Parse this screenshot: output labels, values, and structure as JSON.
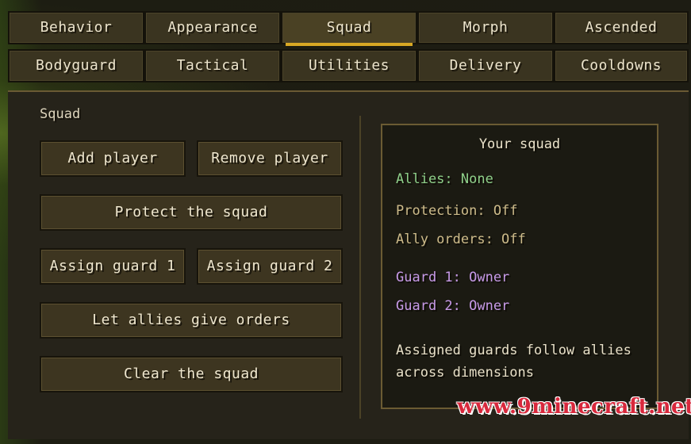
{
  "tabs": {
    "row1": [
      {
        "label": "Behavior",
        "active": false
      },
      {
        "label": "Appearance",
        "active": false
      },
      {
        "label": "Squad",
        "active": true
      },
      {
        "label": "Morph",
        "active": false
      },
      {
        "label": "Ascended",
        "active": false
      }
    ],
    "row2": [
      {
        "label": "Bodyguard",
        "active": false
      },
      {
        "label": "Tactical",
        "active": false
      },
      {
        "label": "Utilities",
        "active": false
      },
      {
        "label": "Delivery",
        "active": false
      },
      {
        "label": "Cooldowns",
        "active": false
      }
    ]
  },
  "section": {
    "title": "Squad"
  },
  "buttons": {
    "add_player": "Add player",
    "remove_player": "Remove player",
    "protect_squad": "Protect the squad",
    "assign_guard_1": "Assign guard 1",
    "assign_guard_2": "Assign guard 2",
    "let_allies_orders": "Let allies give orders",
    "clear_squad": "Clear the squad"
  },
  "info": {
    "title": "Your squad",
    "allies": "Allies: None",
    "protection": "Protection: Off",
    "ally_orders": "Ally orders: Off",
    "guard1": "Guard 1: Owner",
    "guard2": "Guard 2: Owner",
    "note_line1": "Assigned guards follow allies",
    "note_line2": "across dimensions"
  },
  "colors": {
    "accent": "#d8a824",
    "allies_text": "#8fd08a",
    "status_text": "#cdbb8a",
    "guard_text": "#c79ae8"
  },
  "watermark": "www.9minecraft.net"
}
